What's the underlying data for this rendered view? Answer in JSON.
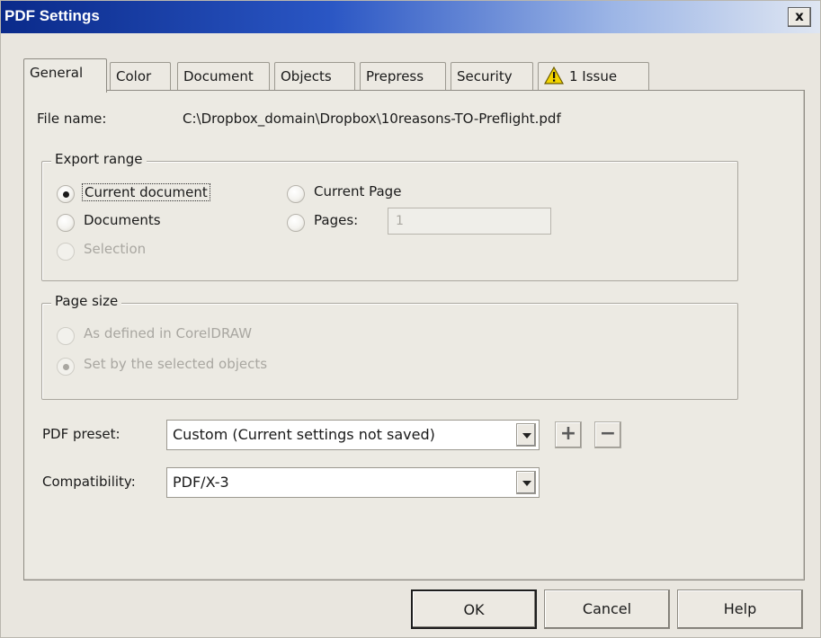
{
  "window": {
    "title": "PDF Settings",
    "close_label": "x"
  },
  "tabs": [
    {
      "label": "General"
    },
    {
      "label": "Color"
    },
    {
      "label": "Document"
    },
    {
      "label": "Objects"
    },
    {
      "label": "Prepress"
    },
    {
      "label": "Security"
    },
    {
      "label": "1 Issue",
      "icon": "warning-icon"
    }
  ],
  "file": {
    "label": "File name:",
    "path": "C:\\Dropbox_domain\\Dropbox\\10reasons-TO-Preflight.pdf"
  },
  "export_range": {
    "title": "Export range",
    "current_document": "Current document",
    "documents": "Documents",
    "selection": "Selection",
    "current_page": "Current Page",
    "pages": "Pages:",
    "pages_value": "1",
    "selected": "current_document"
  },
  "page_size": {
    "title": "Page size",
    "as_defined": "As defined in CorelDRAW",
    "set_by_selected": "Set by the selected objects",
    "selected": "set_by_selected"
  },
  "pdf_preset": {
    "label": "PDF preset:",
    "value": "Custom (Current settings not saved)",
    "add_icon": "plus-icon",
    "remove_icon": "minus-icon"
  },
  "compatibility": {
    "label": "Compatibility:",
    "value": "PDF/X-3"
  },
  "buttons": {
    "ok": "OK",
    "cancel": "Cancel",
    "help": "Help"
  },
  "colors": {
    "title_bar": "#0a2a8a",
    "warning": "#f2d400",
    "dialog_bg": "#eceae3"
  }
}
